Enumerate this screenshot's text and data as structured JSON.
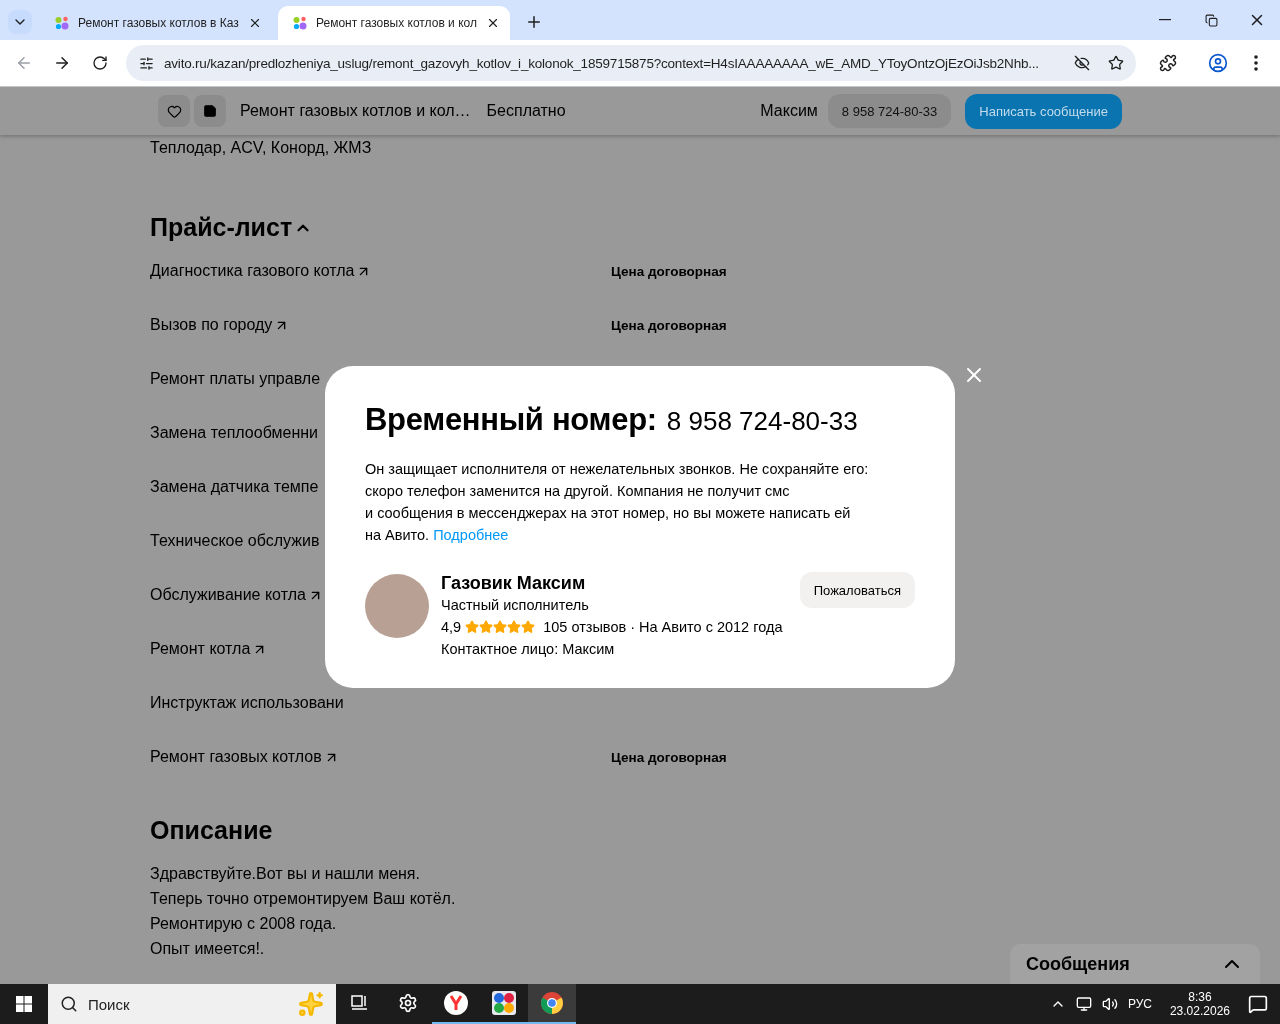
{
  "browser": {
    "tabs": [
      {
        "title": "Ремонт газовых котлов в Каз",
        "selected": false
      },
      {
        "title": "Ремонт газовых котлов и кол",
        "selected": true
      }
    ],
    "url": "avito.ru/kazan/predlozheniya_uslug/remont_gazovyh_kotlov_i_kolonok_1859715875?context=H4sIAAAAAAAA_wE_AMD_YToyOntzOjEzOiJsb2Nhb..."
  },
  "sticky_header": {
    "title": "Ремонт газовых котлов и кол…",
    "price": "Бесплатно",
    "seller": "Максим",
    "phone": "8 958 724-80-33",
    "message_button": "Написать сообщение"
  },
  "page": {
    "brands_line": "Теплодар, ACV, Конорд, ЖМЗ",
    "price_list": {
      "title": "Прайс-лист",
      "expanded": true,
      "items": [
        {
          "name": "Диагностика газового котла",
          "link": true,
          "price": "Цена договорная"
        },
        {
          "name": "Вызов по городу",
          "link": true,
          "price": "Цена договорная"
        },
        {
          "name": "Ремонт платы управле"
        },
        {
          "name": "Замена теплообменни"
        },
        {
          "name": "Замена датчика темпе"
        },
        {
          "name": "Техническое обслужив"
        },
        {
          "name": "Обслуживание котла",
          "link": true
        },
        {
          "name": "Ремонт котла",
          "link": true
        },
        {
          "name": "Инструктаж использовани"
        },
        {
          "name": "Ремонт газовых котлов",
          "link": true,
          "price": "Цена договорная"
        }
      ]
    },
    "description": {
      "title": "Описание",
      "lines": [
        "Здравствуйте.Вот вы и нашли меня.",
        "Теперь точно отремонтируем Ваш котёл.",
        "Ремонтирую с 2008 года.",
        "Опыт имеется!."
      ]
    }
  },
  "modal": {
    "title": "Временный номер:",
    "phone": "8 958 724-80-33",
    "text": "Он защищает исполнителя от нежелательных звонков. Не сохраняйте его:\nскоро телефон заменится на другой. Компания не получит смс\nи сообщения в мессенджерах на этот номер, но вы можете написать ей\nна Авито.",
    "link": "Подробнее",
    "seller": {
      "name": "Газовик Максим",
      "type": "Частный исполнитель",
      "rating": "4,9",
      "stars": 5,
      "reviews": "105 отзывов",
      "since": "· На Авито с 2012 года",
      "contact": "Контактное лицо: Максим"
    },
    "report_button": "Пожаловаться"
  },
  "messages_panel": {
    "title": "Сообщения",
    "expanded": false
  },
  "taskbar": {
    "search_placeholder": "Поиск",
    "apps": [
      {
        "kind": "taskview",
        "running": false,
        "active": false
      },
      {
        "kind": "settings",
        "running": false,
        "active": false
      },
      {
        "kind": "yandex",
        "running": true,
        "active": false
      },
      {
        "kind": "tiles",
        "running": true,
        "active": false
      },
      {
        "kind": "chrome",
        "running": true,
        "active": true
      }
    ],
    "language": "РУС",
    "time": "8:36",
    "date": "23.02.2026"
  }
}
